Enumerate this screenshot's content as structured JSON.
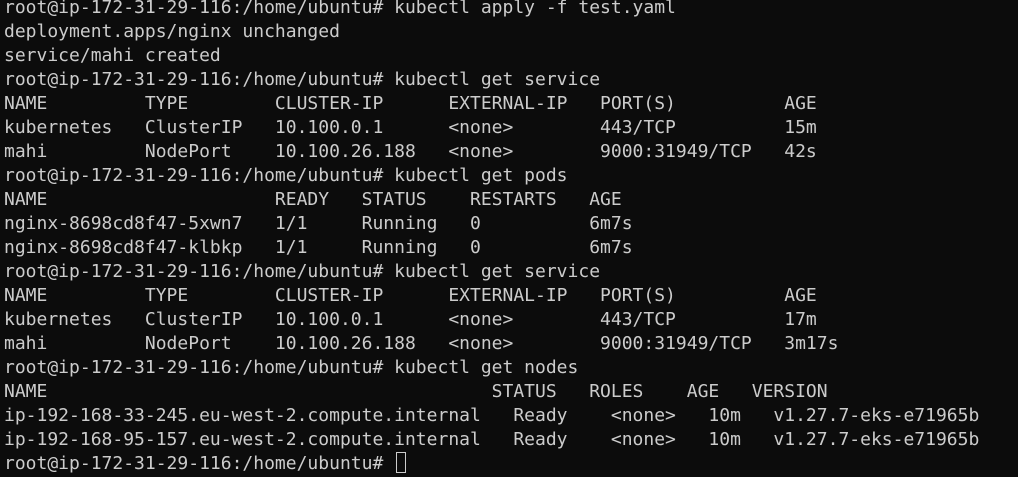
{
  "terminal": {
    "lines": [
      "root@ip-172-31-29-116:/home/ubuntu# kubectl apply -f test.yaml",
      "deployment.apps/nginx unchanged",
      "service/mahi created",
      "root@ip-172-31-29-116:/home/ubuntu# kubectl get service",
      "NAME         TYPE        CLUSTER-IP      EXTERNAL-IP   PORT(S)          AGE",
      "kubernetes   ClusterIP   10.100.0.1      <none>        443/TCP          15m",
      "mahi         NodePort    10.100.26.188   <none>        9000:31949/TCP   42s",
      "root@ip-172-31-29-116:/home/ubuntu# kubectl get pods",
      "NAME                     READY   STATUS    RESTARTS   AGE",
      "nginx-8698cd8f47-5xwn7   1/1     Running   0          6m7s",
      "nginx-8698cd8f47-klbkp   1/1     Running   0          6m7s",
      "root@ip-172-31-29-116:/home/ubuntu# kubectl get service",
      "NAME         TYPE        CLUSTER-IP      EXTERNAL-IP   PORT(S)          AGE",
      "kubernetes   ClusterIP   10.100.0.1      <none>        443/TCP          17m",
      "mahi         NodePort    10.100.26.188   <none>        9000:31949/TCP   3m17s",
      "root@ip-172-31-29-116:/home/ubuntu# kubectl get nodes",
      "NAME                                         STATUS   ROLES    AGE   VERSION",
      "ip-192-168-33-245.eu-west-2.compute.internal   Ready    <none>   10m   v1.27.7-eks-e71965b",
      "ip-192-168-95-157.eu-west-2.compute.internal   Ready    <none>   10m   v1.27.7-eks-e71965b"
    ],
    "prompt": "root@ip-172-31-29-116:/home/ubuntu# ",
    "colors": {
      "background": "#0c0c0c",
      "foreground": "#cccccc"
    }
  }
}
